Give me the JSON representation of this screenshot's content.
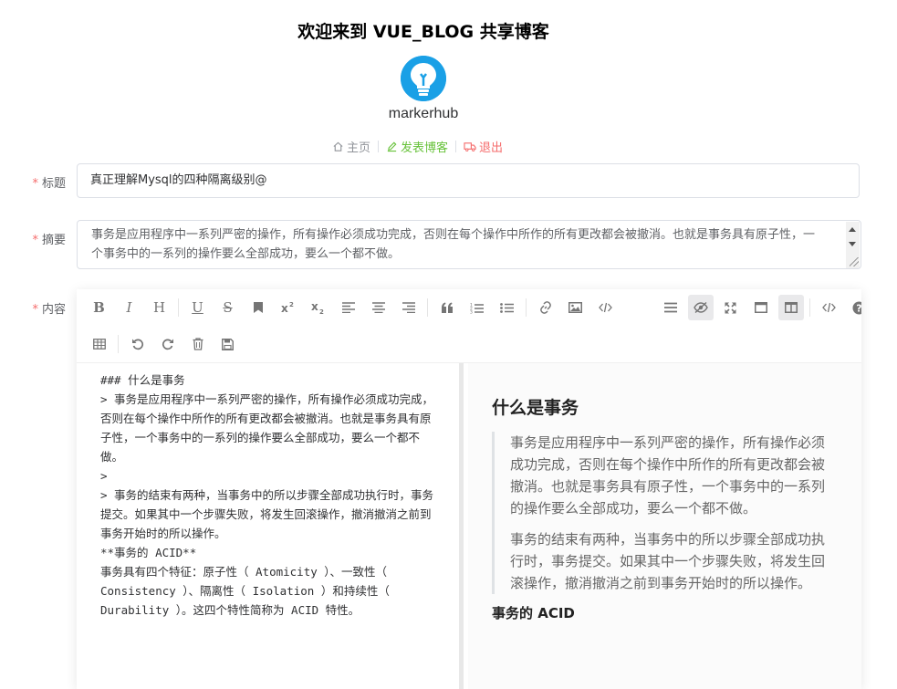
{
  "header": {
    "site_title": "欢迎来到 VUE_BLOG 共享博客",
    "username": "markerhub",
    "nav": {
      "home": "主页",
      "write": "发表博客",
      "logout": "退出"
    }
  },
  "form": {
    "title_label": "标题",
    "title_value": "真正理解Mysql的四种隔离级别@",
    "summary_label": "摘要",
    "summary_value": "事务是应用程序中一系列严密的操作，所有操作必须成功完成，否则在每个操作中所作的所有更改都会被撤消。也就是事务具有原子性，一个事务中的一系列的操作要么全部成功，要么一个都不做。",
    "content_label": "内容",
    "required_mark": "*"
  },
  "editor": {
    "markdown_lines": [
      "### 什么是事务",
      "",
      "> 事务是应用程序中一系列严密的操作，所有操作必须成功完成，否则在每个操作中所作的所有更改都会被撤消。也就是事务具有原子性，一个事务中的一系列的操作要么全部成功，要么一个都不做。",
      ">",
      "> 事务的结束有两种，当事务中的所以步骤全部成功执行时，事务提交。如果其中一个步骤失败，将发生回滚操作，撤消撤消之前到事务开始时的所以操作。",
      "",
      "**事务的 ACID**",
      "",
      "事务具有四个特征：原子性（ Atomicity ）、一致性（ Consistency ）、隔离性（ Isolation ）和持续性（ Durability ）。这四个特性简称为 ACID 特性。"
    ],
    "preview": {
      "heading": "什么是事务",
      "quote_p1": "事务是应用程序中一系列严密的操作，所有操作必须成功完成，否则在每个操作中所作的所有更改都会被撤消。也就是事务具有原子性，一个事务中的一系列的操作要么全部成功，要么一个都不做。",
      "quote_p2": "事务的结束有两种，当事务中的所以步骤全部成功执行时，事务提交。如果其中一个步骤失败，将发生回滚操作，撤消撤消之前到事务开始时的所以操作。",
      "subheading": "事务的 ACID"
    },
    "toolbar_glyphs": {
      "bold": "B",
      "italic": "I",
      "header": "H",
      "underline": "U",
      "strike": "S"
    }
  },
  "colors": {
    "required": "#f56c6c",
    "write_link": "#67c23a",
    "logout_link": "#f56c6c",
    "home_link": "#909399",
    "avatar_bg": "#1aa0e6"
  }
}
